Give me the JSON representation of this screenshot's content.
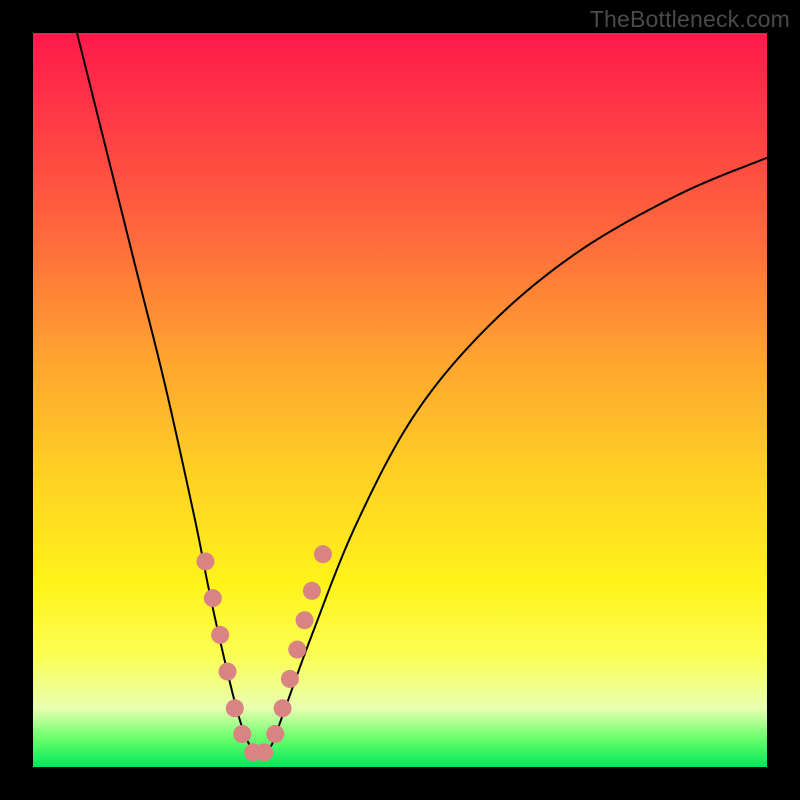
{
  "watermark": "TheBottleneck.com",
  "chart_data": {
    "type": "line",
    "title": "",
    "xlabel": "",
    "ylabel": "",
    "xlim": [
      0,
      100
    ],
    "ylim": [
      0,
      100
    ],
    "grid": false,
    "series": [
      {
        "name": "bottleneck-curve",
        "x": [
          6,
          10,
          14,
          18,
          22,
          24,
          26,
          28,
          29.5,
          31,
          32.5,
          34,
          38,
          44,
          52,
          62,
          74,
          88,
          100
        ],
        "y": [
          100,
          84,
          68,
          52,
          34,
          24,
          15,
          7,
          3,
          1.5,
          3,
          7,
          18,
          33,
          48,
          60,
          70,
          78,
          83
        ]
      }
    ],
    "markers": {
      "name": "marker-dots",
      "color": "#d98383",
      "points": [
        {
          "x": 23.5,
          "y": 28
        },
        {
          "x": 24.5,
          "y": 23
        },
        {
          "x": 25.5,
          "y": 18
        },
        {
          "x": 26.5,
          "y": 13
        },
        {
          "x": 27.5,
          "y": 8
        },
        {
          "x": 28.5,
          "y": 4.5
        },
        {
          "x": 30,
          "y": 2
        },
        {
          "x": 31.5,
          "y": 2
        },
        {
          "x": 33,
          "y": 4.5
        },
        {
          "x": 34,
          "y": 8
        },
        {
          "x": 35,
          "y": 12
        },
        {
          "x": 36,
          "y": 16
        },
        {
          "x": 37,
          "y": 20
        },
        {
          "x": 38,
          "y": 24
        },
        {
          "x": 39.5,
          "y": 29
        }
      ]
    },
    "colors": {
      "gradient_top": "#ff1a4c",
      "gradient_mid": "#fff31a",
      "gradient_bottom": "#00e85b",
      "curve": "#000000",
      "marker": "#d98383"
    }
  }
}
